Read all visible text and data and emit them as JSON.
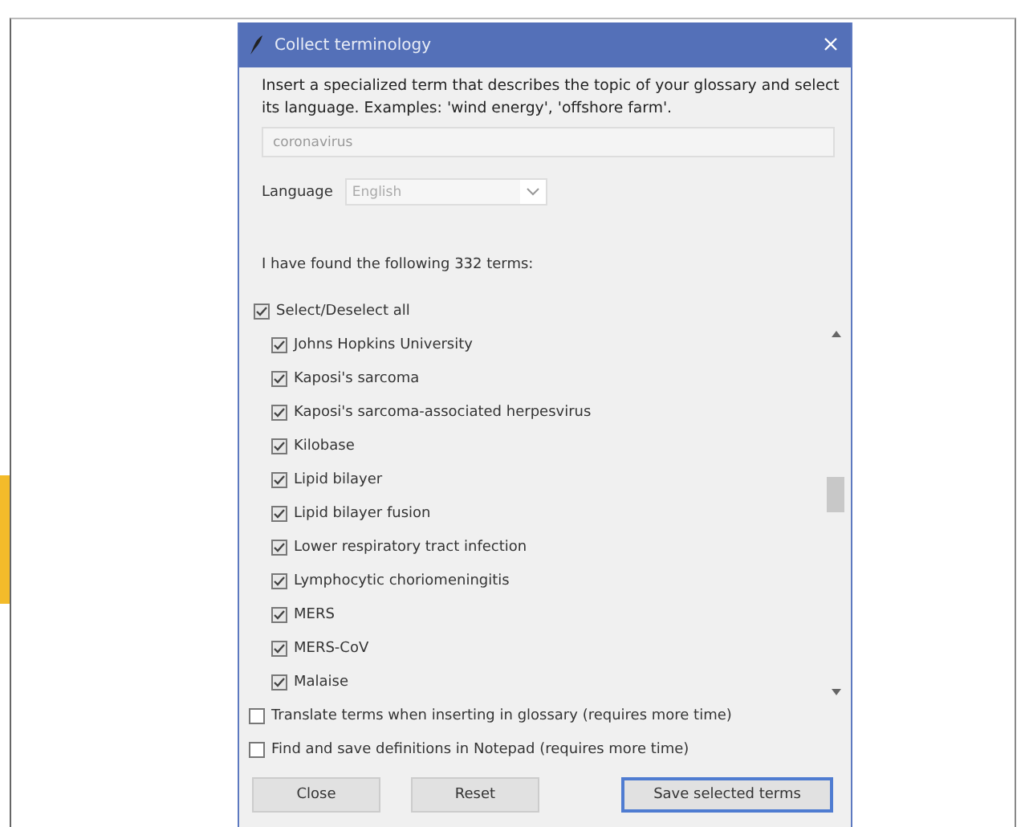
{
  "window": {
    "title": "Collect terminology"
  },
  "description": "Insert a specialized term that describes the topic of your glossary and select its language. Examples: 'wind energy', 'offshore farm'.",
  "term_field": {
    "value": "coronavirus"
  },
  "language": {
    "label": "Language",
    "value": "English"
  },
  "found_text": "I have found the following 332 terms:",
  "select_all": {
    "label": "Select/Deselect all",
    "checked": true
  },
  "terms": [
    {
      "label": "Johns Hopkins University",
      "checked": true
    },
    {
      "label": "Kaposi's sarcoma",
      "checked": true
    },
    {
      "label": "Kaposi's sarcoma-associated herpesvirus",
      "checked": true
    },
    {
      "label": "Kilobase",
      "checked": true
    },
    {
      "label": "Lipid bilayer",
      "checked": true
    },
    {
      "label": "Lipid bilayer fusion",
      "checked": true
    },
    {
      "label": "Lower respiratory tract infection",
      "checked": true
    },
    {
      "label": "Lymphocytic choriomeningitis",
      "checked": true
    },
    {
      "label": "MERS",
      "checked": true
    },
    {
      "label": "MERS-CoV",
      "checked": true
    },
    {
      "label": "Malaise",
      "checked": true
    }
  ],
  "options": [
    {
      "label": "Translate terms when inserting in glossary (requires more time)",
      "checked": false
    },
    {
      "label": "Find and save definitions in Notepad (requires more time)",
      "checked": false
    }
  ],
  "buttons": [
    {
      "label": "Close",
      "kind": "plain"
    },
    {
      "label": "Reset",
      "kind": "plain"
    },
    {
      "label": "Save selected terms",
      "kind": "default"
    }
  ]
}
